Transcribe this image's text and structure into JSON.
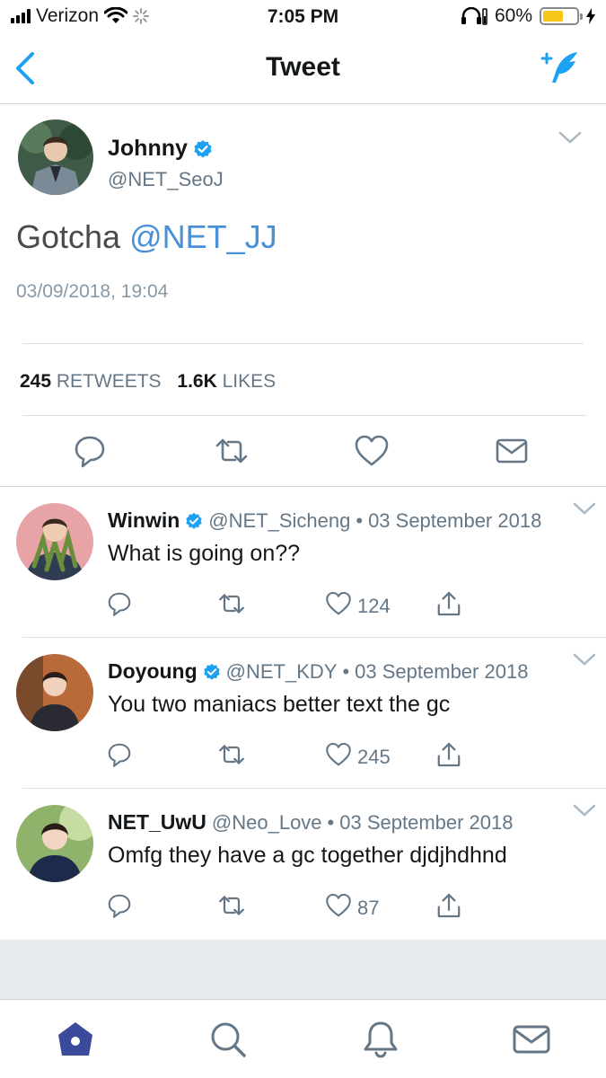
{
  "status_bar": {
    "carrier": "Verizon",
    "time": "7:05 PM",
    "battery": "60%",
    "battery_level": 0.6
  },
  "nav": {
    "title": "Tweet",
    "back_icon": "chevron-left-icon",
    "compose_icon": "compose-tweet-icon"
  },
  "tweet": {
    "name": "Johnny",
    "handle": "@NET_SeoJ",
    "text": "Gotcha ",
    "mention": "@NET_JJ",
    "timestamp": "03/09/2018, 19:04",
    "retweets_count": "245",
    "retweets_label": "RETWEETS",
    "likes_count": "1.6K",
    "likes_label": "LIKES",
    "verified": true
  },
  "replies": [
    {
      "name": "Winwin",
      "verified": true,
      "handle": "@NET_Sicheng",
      "dot": "•",
      "date": "03 September 2018",
      "text": "What is going on??",
      "likes": "124"
    },
    {
      "name": "Doyoung",
      "verified": true,
      "handle": "@NET_KDY",
      "dot": "•",
      "date": "03 September 2018",
      "text": "You two maniacs better text the gc",
      "likes": "245"
    },
    {
      "name": "NET_UwU",
      "verified": false,
      "handle": "@Neo_Love",
      "dot": "•",
      "date": "03 September 2018",
      "text": "Omfg they have a gc together djdjhdhnd",
      "likes": "87"
    }
  ],
  "tab_bar": {
    "items": [
      "home-icon",
      "search-icon",
      "notifications-bell-icon",
      "messages-envelope-icon"
    ]
  },
  "colors": {
    "accent": "#1da1f2",
    "mention": "#4a90d6",
    "verified": "#1da1f2",
    "home_tab": "#3b4a9a",
    "secondary_text": "#657786"
  }
}
